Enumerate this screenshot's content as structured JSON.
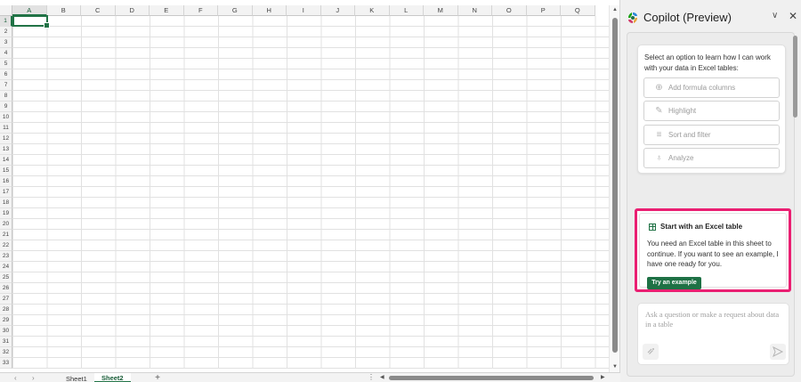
{
  "sheet": {
    "columns": [
      "A",
      "B",
      "C",
      "D",
      "E",
      "F",
      "G",
      "H",
      "I",
      "J",
      "K",
      "L",
      "M",
      "N",
      "O",
      "P",
      "Q"
    ],
    "rows": [
      "1",
      "2",
      "3",
      "4",
      "5",
      "6",
      "7",
      "8",
      "9",
      "10",
      "11",
      "12",
      "13",
      "14",
      "15",
      "16",
      "17",
      "18",
      "19",
      "20",
      "21",
      "22",
      "23",
      "24",
      "25",
      "26",
      "27",
      "28",
      "29",
      "30",
      "31",
      "32",
      "33"
    ],
    "active_cell": "A1",
    "tabs": [
      {
        "label": "Sheet1",
        "active": false
      },
      {
        "label": "Sheet2",
        "active": true
      }
    ],
    "add_sheet_label": "+",
    "hscroll_dots": "⋮"
  },
  "copilot": {
    "title": "Copilot (Preview)",
    "options_card": {
      "intro": "Select an option to learn how I can work with your data in Excel tables:",
      "options": [
        {
          "label": "Add formula columns",
          "icon": "plus-circle-icon"
        },
        {
          "label": "Highlight",
          "icon": "pen-icon"
        },
        {
          "label": "Sort and filter",
          "icon": "filter-lines-icon"
        },
        {
          "label": "Analyze",
          "icon": "lightbulb-icon"
        }
      ]
    },
    "table_card": {
      "title": "Start with an Excel table",
      "body": "You need an Excel table in this sheet to continue. If you want to see an example, I have one ready for you.",
      "button": "Try an example",
      "highlight_color": "#ea1f72"
    },
    "ask": {
      "placeholder": "Ask a question or make a request about data in a table"
    }
  },
  "colors": {
    "excel_green": "#217346",
    "button_green": "#1e7145"
  }
}
